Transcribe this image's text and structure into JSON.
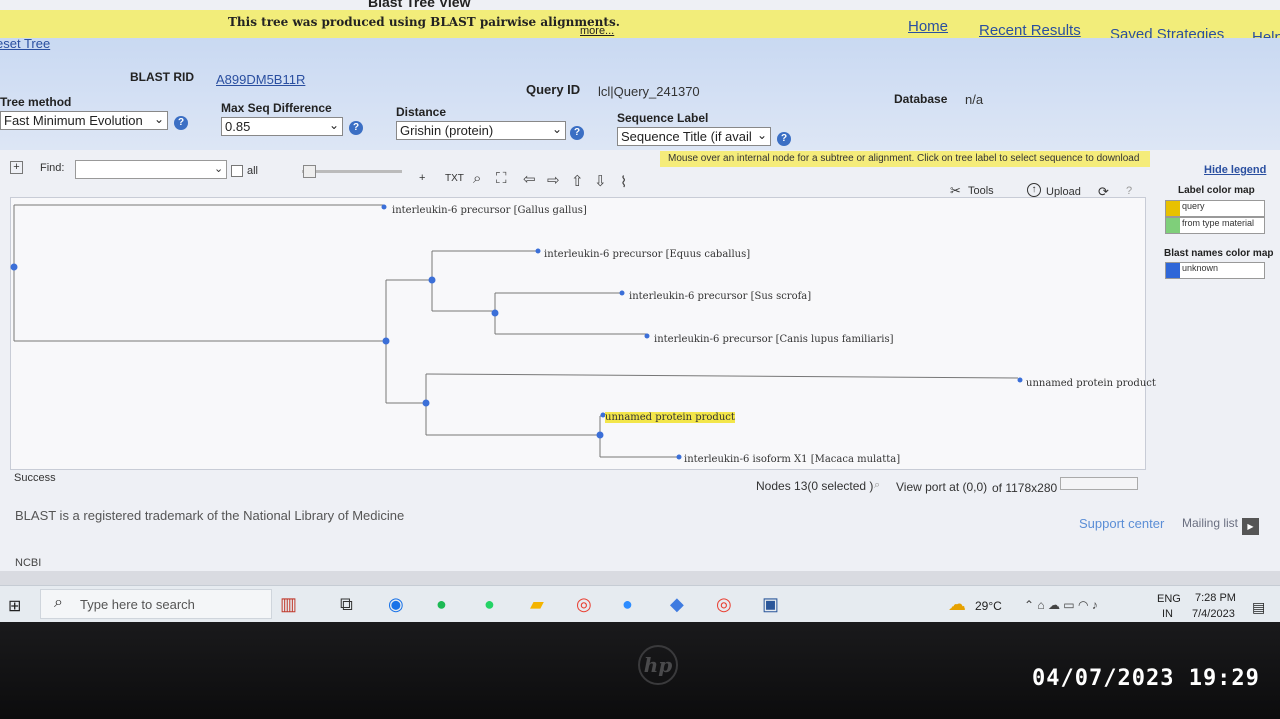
{
  "page": {
    "title": "Blast Tree View",
    "banner_text": "This tree was produced using BLAST pairwise alignments.",
    "banner_more": "more...",
    "reset_tree": "eset Tree"
  },
  "nav": {
    "home": "Home",
    "recent": "Recent Results",
    "saved": "Saved Strategies",
    "help": "Help"
  },
  "info": {
    "rid_label": "BLAST RID",
    "rid_value": "A899DM5B11R",
    "query_label": "Query ID",
    "query_value": "lcl|Query_241370",
    "db_label": "Database",
    "db_value": "n/a"
  },
  "controls": {
    "tree_method_label": "Tree method",
    "tree_method_value": "Fast Minimum Evolution",
    "max_seq_label": "Max Seq Difference",
    "max_seq_value": "0.85",
    "distance_label": "Distance",
    "distance_value": "Grishin (protein)",
    "seq_label_label": "Sequence Label",
    "seq_label_value": "Sequence Title (if avail"
  },
  "toolbar": {
    "hint": "Mouse over an internal node for a subtree or alignment. Click on tree label to select sequence to download",
    "find_label": "Find:",
    "all_label": "all",
    "plus_label": "+",
    "txt_label": "TXT",
    "tools_label": "Tools",
    "upload_label": "Upload"
  },
  "tree": {
    "leaves": [
      "interleukin-6 precursor [Gallus gallus]",
      "interleukin-6 precursor [Equus caballus]",
      "interleukin-6 precursor [Sus scrofa]",
      "interleukin-6 precursor [Canis lupus familiaris]",
      "unnamed protein product",
      "unnamed protein product",
      "interleukin-6 isoform X1 [Macaca mulatta]"
    ],
    "selected_leaf_index": 5
  },
  "legend": {
    "hide": "Hide legend",
    "label_map_title": "Label color map",
    "label_items": [
      {
        "label": "query",
        "color": "#e8c100"
      },
      {
        "label": "from type material",
        "color": "#7fcf7a"
      }
    ],
    "blast_map_title": "Blast names color map",
    "blast_items": [
      {
        "label": "unknown",
        "color": "#2f67d8"
      }
    ]
  },
  "status": {
    "result": "Success",
    "nodes": "Nodes 13(0 selected )",
    "viewport": "View port at (0,0)",
    "size": "of 1178x280"
  },
  "footer": {
    "trademark": "BLAST is a registered trademark of the National Library of Medicine",
    "support": "Support center",
    "mailing": "Mailing list",
    "ncbi": "NCBI"
  },
  "taskbar": {
    "search_placeholder": "Type here to search",
    "weather": "29°C",
    "lang_top": "ENG",
    "lang_bottom": "IN",
    "time": "7:28 PM",
    "date": "7/4/2023"
  },
  "photo": {
    "timestamp": "04/07/2023 19:29",
    "brand": "hp"
  }
}
